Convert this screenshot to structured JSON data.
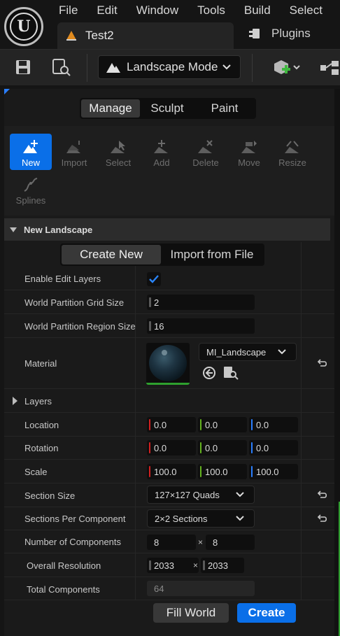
{
  "menu": {
    "items": [
      "File",
      "Edit",
      "Window",
      "Tools",
      "Build",
      "Select"
    ]
  },
  "tabs": {
    "active_label": "Test2",
    "plugins_label": "Plugins"
  },
  "toolbar": {
    "mode_label": "Landscape Mode"
  },
  "mode_tabs": [
    "Manage",
    "Sculpt",
    "Paint"
  ],
  "tools": [
    "New",
    "Import",
    "Select",
    "Add",
    "Delete",
    "Move",
    "Resize",
    "Splines"
  ],
  "new_landscape": {
    "header": "New Landscape",
    "source_tabs": [
      "Create New",
      "Import from File"
    ],
    "labels": {
      "enable_edit_layers": "Enable Edit Layers",
      "grid_size": "World Partition Grid Size",
      "region_size": "World Partition Region Size",
      "material": "Material",
      "layers": "Layers",
      "location": "Location",
      "rotation": "Rotation",
      "scale": "Scale",
      "section_size": "Section Size",
      "sections_per_component": "Sections Per Component",
      "num_components": "Number of Components",
      "overall_resolution": "Overall Resolution",
      "total_components": "Total Components"
    },
    "values": {
      "enable_edit_layers": true,
      "grid_size": "2",
      "region_size": "16",
      "material": "MI_Landscape",
      "location": [
        "0.0",
        "0.0",
        "0.0"
      ],
      "rotation": [
        "0.0",
        "0.0",
        "0.0"
      ],
      "scale": [
        "100.0",
        "100.0",
        "100.0"
      ],
      "section_size": "127×127 Quads",
      "sections_per_component": "2×2 Sections",
      "num_components": [
        "8",
        "8"
      ],
      "overall_resolution": [
        "2033",
        "2033"
      ],
      "total_components": "64",
      "times_symbol": "×"
    },
    "buttons": {
      "fill_world": "Fill World",
      "create": "Create"
    }
  },
  "colors": {
    "accent": "#0a6fe8",
    "x_axis": "#d32020",
    "y_axis": "#63b21f",
    "z_axis": "#2a7fff"
  }
}
